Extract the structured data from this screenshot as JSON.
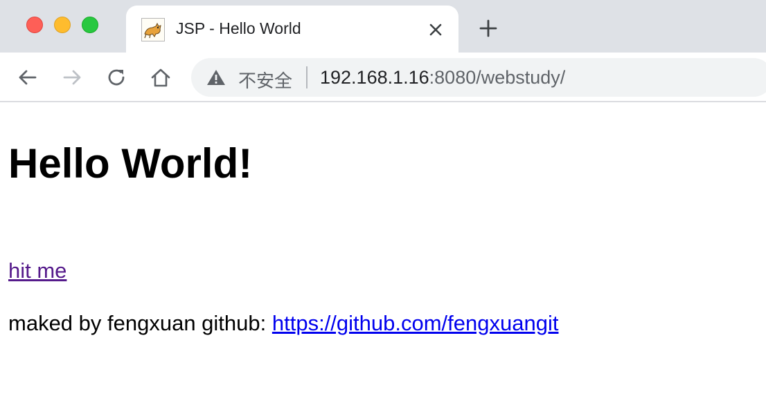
{
  "browser": {
    "tab": {
      "title": "JSP - Hello World",
      "favicon": "tomcat-cat-icon"
    },
    "address_bar": {
      "security_label": "不安全",
      "url_host": "192.168.1.16",
      "url_rest": ":8080/webstudy/"
    },
    "icons": {
      "back": "arrow-left-icon",
      "forward": "arrow-right-icon",
      "reload": "reload-icon",
      "home": "home-icon",
      "close_tab": "close-icon",
      "new_tab": "plus-icon",
      "warning": "warning-triangle-icon"
    },
    "colors": {
      "tabstrip": "#dee1e6",
      "omnibox": "#f1f3f4",
      "visited_link": "#551a8b",
      "link": "#0000ee"
    }
  },
  "page": {
    "heading": "Hello World!",
    "hit_link": "hit me",
    "credit_text": "maked by fengxuan github: ",
    "github_link": "https://github.com/fengxuangit"
  }
}
